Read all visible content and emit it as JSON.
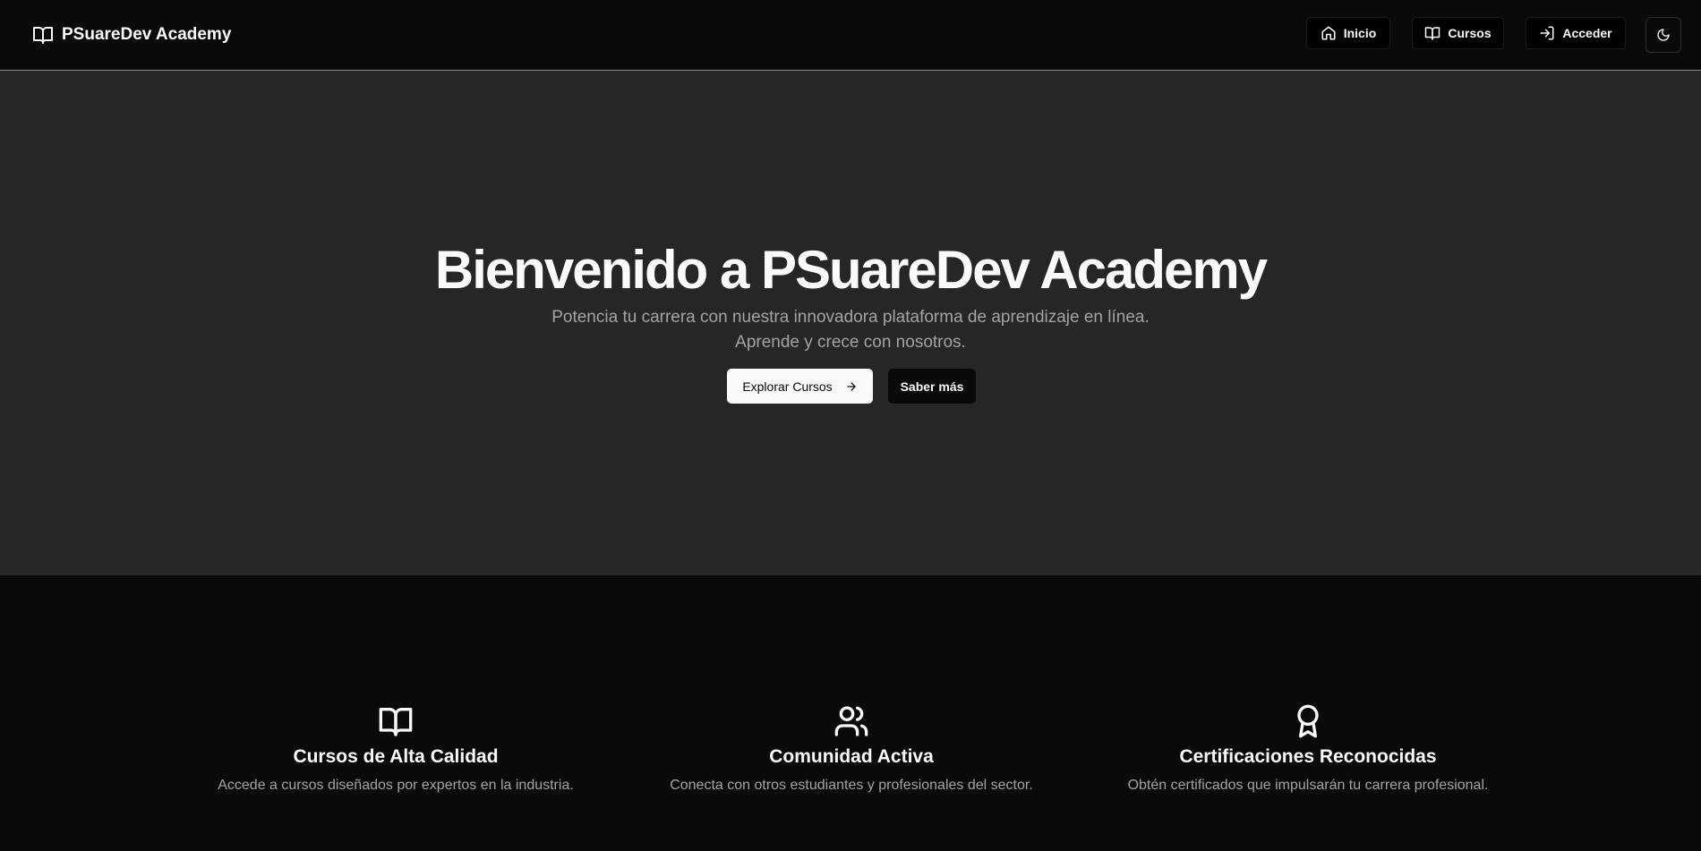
{
  "header": {
    "brand": "PSuareDev Academy",
    "nav": {
      "inicio": "Inicio",
      "cursos": "Cursos",
      "acceder": "Acceder"
    },
    "theme_toggle_icon": "moon-icon"
  },
  "hero": {
    "title": "Bienvenido a PSuareDev Academy",
    "subtitle_line1": "Potencia tu carrera con nuestra innovadora plataforma de aprendizaje en línea.",
    "subtitle_line2": "Aprende y crece con nosotros.",
    "primary_button": "Explorar Cursos",
    "secondary_button": "Saber más"
  },
  "features": [
    {
      "icon": "book-open-icon",
      "title": "Cursos de Alta Calidad",
      "description": "Accede a cursos diseñados por expertos en la industria."
    },
    {
      "icon": "users-icon",
      "title": "Comunidad Activa",
      "description": "Conecta con otros estudiantes y profesionales del sector."
    },
    {
      "icon": "award-icon",
      "title": "Certificaciones Reconocidas",
      "description": "Obtén certificados que impulsarán tu carrera profesional."
    }
  ],
  "colors": {
    "header_bg": "#0a0a0a",
    "hero_bg": "#262626",
    "features_bg": "#0a0a0a",
    "text_primary": "#fafafa",
    "text_muted": "#a3a3a3"
  }
}
